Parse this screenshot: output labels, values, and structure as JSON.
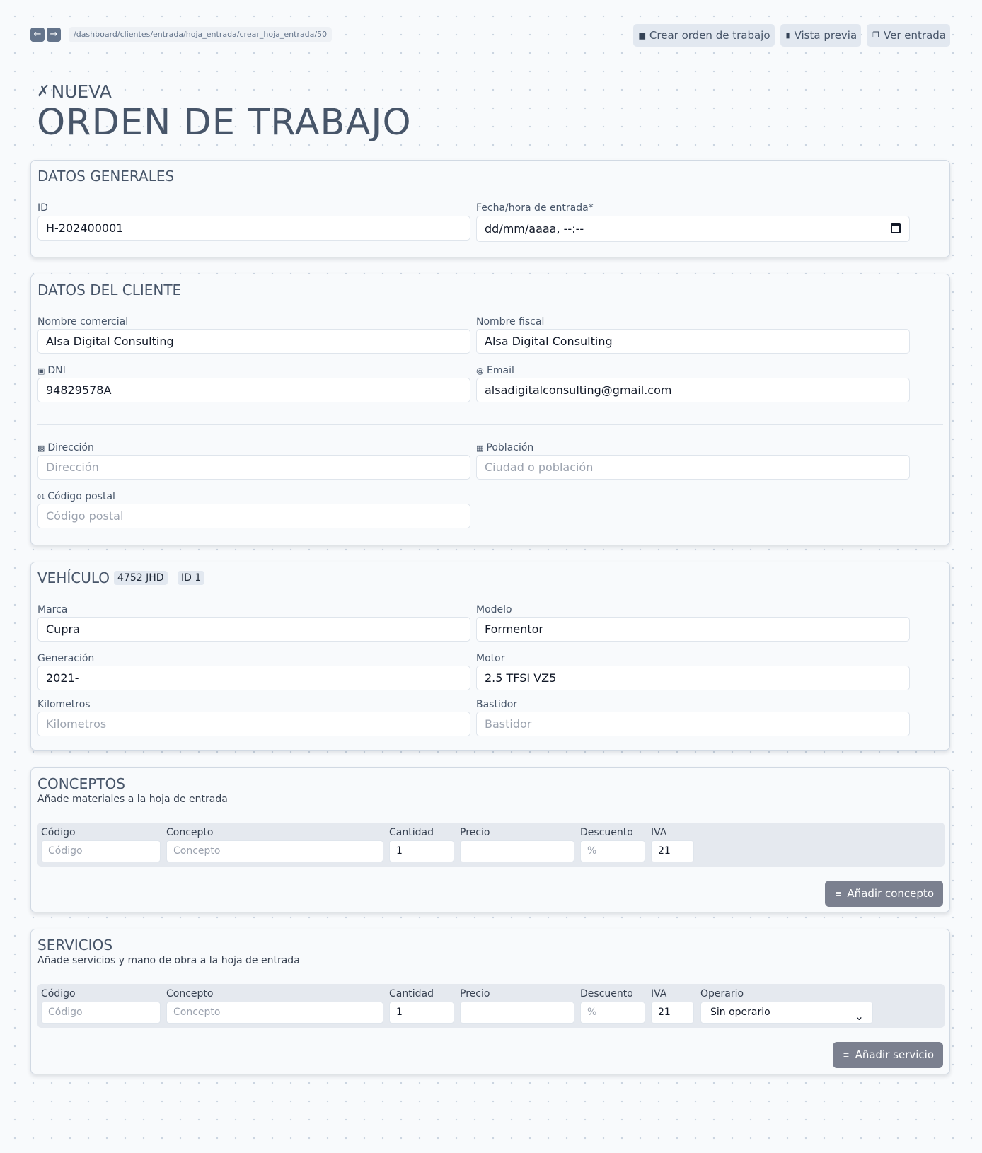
{
  "topbar": {
    "back_icon": "←",
    "forward_icon": "→",
    "path": "/dashboard/clientes/entrada/hoja_entrada/crear_hoja_entrada/50",
    "actions": [
      {
        "label": "Crear orden de trabajo",
        "icon": "folder-icon"
      },
      {
        "label": "Vista previa",
        "icon": "pdf-file-icon"
      },
      {
        "label": "Ver entrada",
        "icon": "copy-icon"
      }
    ]
  },
  "header": {
    "small_title": "NUEVA",
    "big_title": "ORDEN DE TRABAJO"
  },
  "datos_generales": {
    "title": "DATOS GENERALES",
    "id_label": "ID",
    "id_value": "H-202400001",
    "fecha_label": "Fecha/hora de entrada*",
    "fecha_value": "dd/mm/aaaa, --:--"
  },
  "cliente": {
    "title": "DATOS DEL CLIENTE",
    "nombre_comercial_label": "Nombre comercial",
    "nombre_comercial_value": "Alsa Digital Consulting",
    "nombre_fiscal_label": "Nombre fiscal",
    "nombre_fiscal_value": "Alsa Digital Consulting",
    "dni_label": "DNI",
    "dni_value": "94829578A",
    "email_label": "Email",
    "email_value": "alsadigitalconsulting@gmail.com",
    "direccion_label": "Dirección",
    "direccion_placeholder": "Dirección",
    "poblacion_label": "Población",
    "poblacion_placeholder": "Ciudad o población",
    "cp_label": "Código postal",
    "cp_placeholder": "Código postal"
  },
  "vehiculo": {
    "title": "VEHÍCULO",
    "plate": "4752 JHD",
    "id_badge": "ID 1",
    "marca_label": "Marca",
    "marca_value": "Cupra",
    "modelo_label": "Modelo",
    "modelo_value": "Formentor",
    "generacion_label": "Generación",
    "generacion_value": "2021-",
    "motor_label": "Motor",
    "motor_value": "2.5 TFSI VZ5",
    "km_label": "Kilometros",
    "km_placeholder": "Kilometros",
    "bastidor_label": "Bastidor",
    "bastidor_placeholder": "Bastidor"
  },
  "conceptos": {
    "title": "CONCEPTOS",
    "subtitle": "Añade materiales a la hoja de entrada",
    "columns": {
      "codigo": "Código",
      "concepto": "Concepto",
      "cantidad": "Cantidad",
      "precio": "Precio",
      "descuento": "Descuento",
      "iva": "IVA"
    },
    "row": {
      "codigo_placeholder": "Código",
      "concepto_placeholder": "Concepto",
      "cantidad": "1",
      "precio": "",
      "descuento_placeholder": "%",
      "iva": "21"
    },
    "add_label": "Añadir concepto"
  },
  "servicios": {
    "title": "SERVICIOS",
    "subtitle": "Añade servicios y mano de obra a la hoja de entrada",
    "columns": {
      "codigo": "Código",
      "concepto": "Concepto",
      "cantidad": "Cantidad",
      "precio": "Precio",
      "descuento": "Descuento",
      "iva": "IVA",
      "operario": "Operario"
    },
    "row": {
      "codigo_placeholder": "Código",
      "concepto_placeholder": "Concepto",
      "cantidad": "1",
      "precio": "",
      "descuento_placeholder": "%",
      "iva": "21",
      "operario": "Sin operario"
    },
    "add_label": "Añadir servicio"
  }
}
